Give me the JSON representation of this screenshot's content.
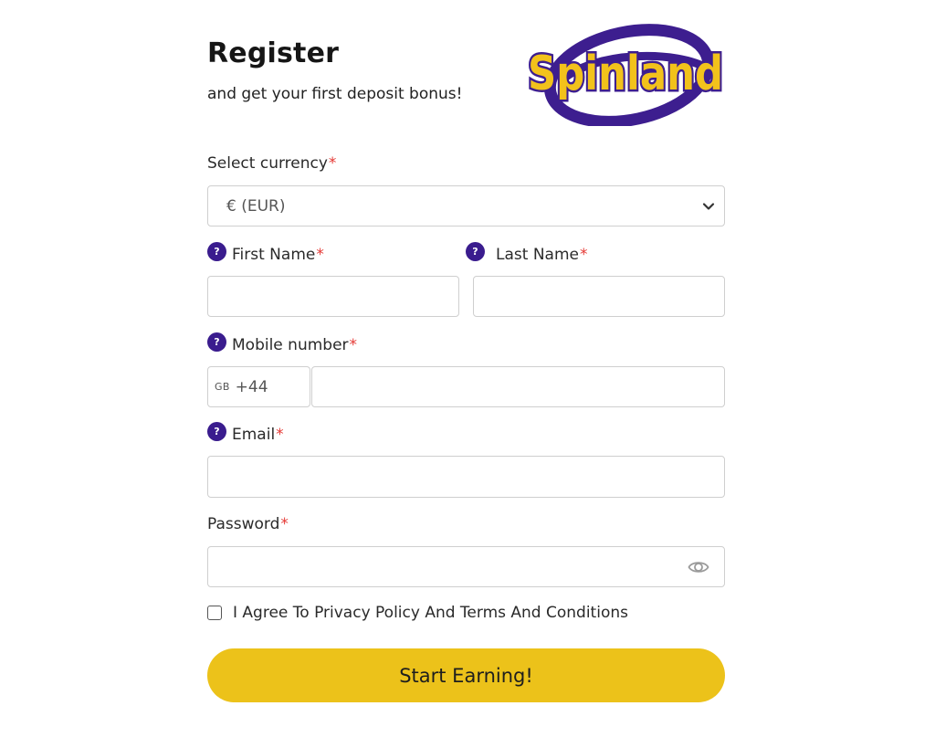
{
  "header": {
    "title": "Register",
    "subtitle": "and get your first deposit bonus!",
    "logo_text": "Spinland"
  },
  "form": {
    "currency": {
      "label": "Select currency",
      "required_mark": "*",
      "selected": "€ (EUR)"
    },
    "first_name": {
      "label": "First Name",
      "required_mark": "*",
      "help_icon": "?"
    },
    "last_name": {
      "label": "Last Name",
      "required_mark": "*",
      "help_icon": "?"
    },
    "mobile": {
      "label": "Mobile number",
      "required_mark": "*",
      "help_icon": "?",
      "country_code": "GB",
      "dial_code": "+44"
    },
    "email": {
      "label": "Email",
      "required_mark": "*",
      "help_icon": "?"
    },
    "password": {
      "label": "Password",
      "required_mark": "*"
    },
    "agree": {
      "label": "I Agree To Privacy Policy And Terms And Conditions"
    },
    "submit_label": "Start Earning!"
  },
  "colors": {
    "accent_yellow": "#ecc21a",
    "help_purple": "#3a1c8e",
    "required_red": "#e53935",
    "logo_purple": "#3d1e8f",
    "logo_yellow": "#f2c21b"
  },
  "icons": {
    "help": "question-circle-icon",
    "chevron": "chevron-down-icon",
    "eye": "eye-icon"
  }
}
